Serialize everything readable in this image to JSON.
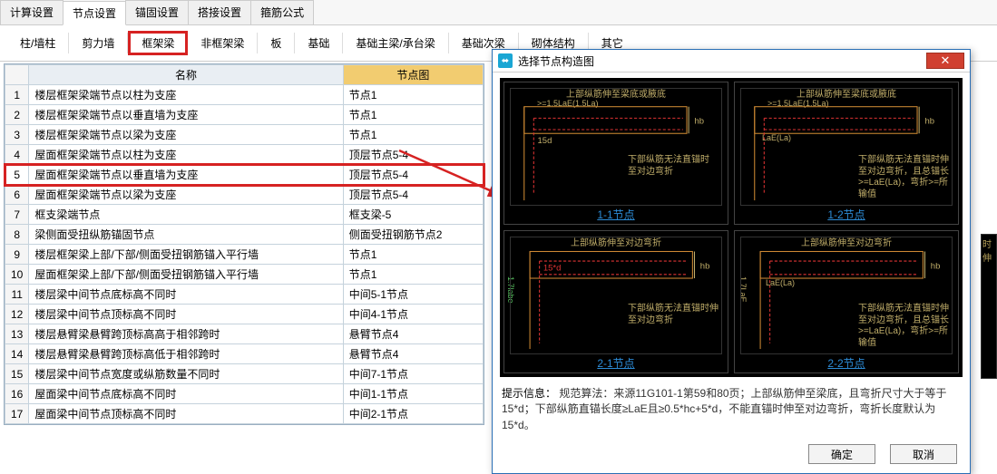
{
  "top_tabs": {
    "t0": "计算设置",
    "t1": "节点设置",
    "t2": "锚固设置",
    "t3": "搭接设置",
    "t4": "箍筋公式",
    "active": 1
  },
  "sub_tabs": {
    "s0": "柱/墙柱",
    "s1": "剪力墙",
    "s2": "框架梁",
    "s3": "非框架梁",
    "s4": "板",
    "s5": "基础",
    "s6": "基础主梁/承台梁",
    "s7": "基础次梁",
    "s8": "砌体结构",
    "s9": "其它",
    "highlight": 2
  },
  "table": {
    "col_name": "名称",
    "col_node": "节点图",
    "rows": [
      {
        "n": 1,
        "name": "楼层框架梁端节点以柱为支座",
        "node": "节点1"
      },
      {
        "n": 2,
        "name": "楼层框架梁端节点以垂直墙为支座",
        "node": "节点1"
      },
      {
        "n": 3,
        "name": "楼层框架梁端节点以梁为支座",
        "node": "节点1"
      },
      {
        "n": 4,
        "name": "屋面框架梁端节点以柱为支座",
        "node": "顶层节点5-4"
      },
      {
        "n": 5,
        "name": "屋面框架梁端节点以垂直墙为支座",
        "node": "顶层节点5-4"
      },
      {
        "n": 6,
        "name": "屋面框架梁端节点以梁为支座",
        "node": "顶层节点5-4"
      },
      {
        "n": 7,
        "name": "框支梁端节点",
        "node": "框支梁-5"
      },
      {
        "n": 8,
        "name": "梁侧面受扭纵筋锚固节点",
        "node": "侧面受扭钢筋节点2"
      },
      {
        "n": 9,
        "name": "楼层框架梁上部/下部/侧面受扭钢筋锚入平行墙",
        "node": "节点1"
      },
      {
        "n": 10,
        "name": "屋面框架梁上部/下部/侧面受扭钢筋锚入平行墙",
        "node": "节点1"
      },
      {
        "n": 11,
        "name": "楼层梁中间节点底标高不同时",
        "node": "中间5-1节点"
      },
      {
        "n": 12,
        "name": "楼层梁中间节点顶标高不同时",
        "node": "中间4-1节点"
      },
      {
        "n": 13,
        "name": "楼层悬臂梁悬臂跨顶标高高于相邻跨时",
        "node": "悬臂节点4"
      },
      {
        "n": 14,
        "name": "楼层悬臂梁悬臂跨顶标高低于相邻跨时",
        "node": "悬臂节点4"
      },
      {
        "n": 15,
        "name": "楼层梁中间节点宽度或纵筋数量不同时",
        "node": "中间7-1节点"
      },
      {
        "n": 16,
        "name": "屋面梁中间节点底标高不同时",
        "node": "中间1-1节点"
      },
      {
        "n": 17,
        "name": "屋面梁中间节点顶标高不同时",
        "node": "中间2-1节点"
      }
    ],
    "highlight_row": 5
  },
  "dialog": {
    "title": "选择节点构造图",
    "cells": {
      "c1": {
        "top": "上部纵筋伸至梁底或腋底",
        "dim": ">=1.5LaE(1.5La)",
        "note": "下部纵筋无法直锚时\n至对边弯折",
        "link": "1-1节点"
      },
      "c2": {
        "top": "上部纵筋伸至梁底或腋底",
        "dim": ">=1.5LaE(1.5La)",
        "dim2": "LaE(La)",
        "note": "下部纵筋无法直锚时伸\n至对边弯折，且总锚长\n>=LaE(La)，弯折>=所输值",
        "link": "1-2节点"
      },
      "c3": {
        "top": "上部纵筋伸至对边弯折",
        "side": "1.7labe",
        "mid": "15*d",
        "note": "下部纵筋无法直锚时伸\n至对边弯折",
        "link": "2-1节点"
      },
      "c4": {
        "top": "上部纵筋伸至对边弯折",
        "side": "1.7LaE",
        "mid": "LaE(La)",
        "note": "下部纵筋无法直锚时伸\n至对边弯折，且总锚长\n>=LaE(La)，弯折>=所输值",
        "link": "2-2节点"
      }
    },
    "hint_label": "提示信息：",
    "hint_text": "规范算法：来源11G101-1第59和80页；上部纵筋伸至梁底，且弯折尺寸大于等于15*d；下部纵筋直锚长度≥LaE且≥0.5*hc+5*d，不能直锚时伸至对边弯折，弯折长度默认为15*d。",
    "ok": "确定",
    "cancel": "取消"
  },
  "sidepeek": "时伸"
}
